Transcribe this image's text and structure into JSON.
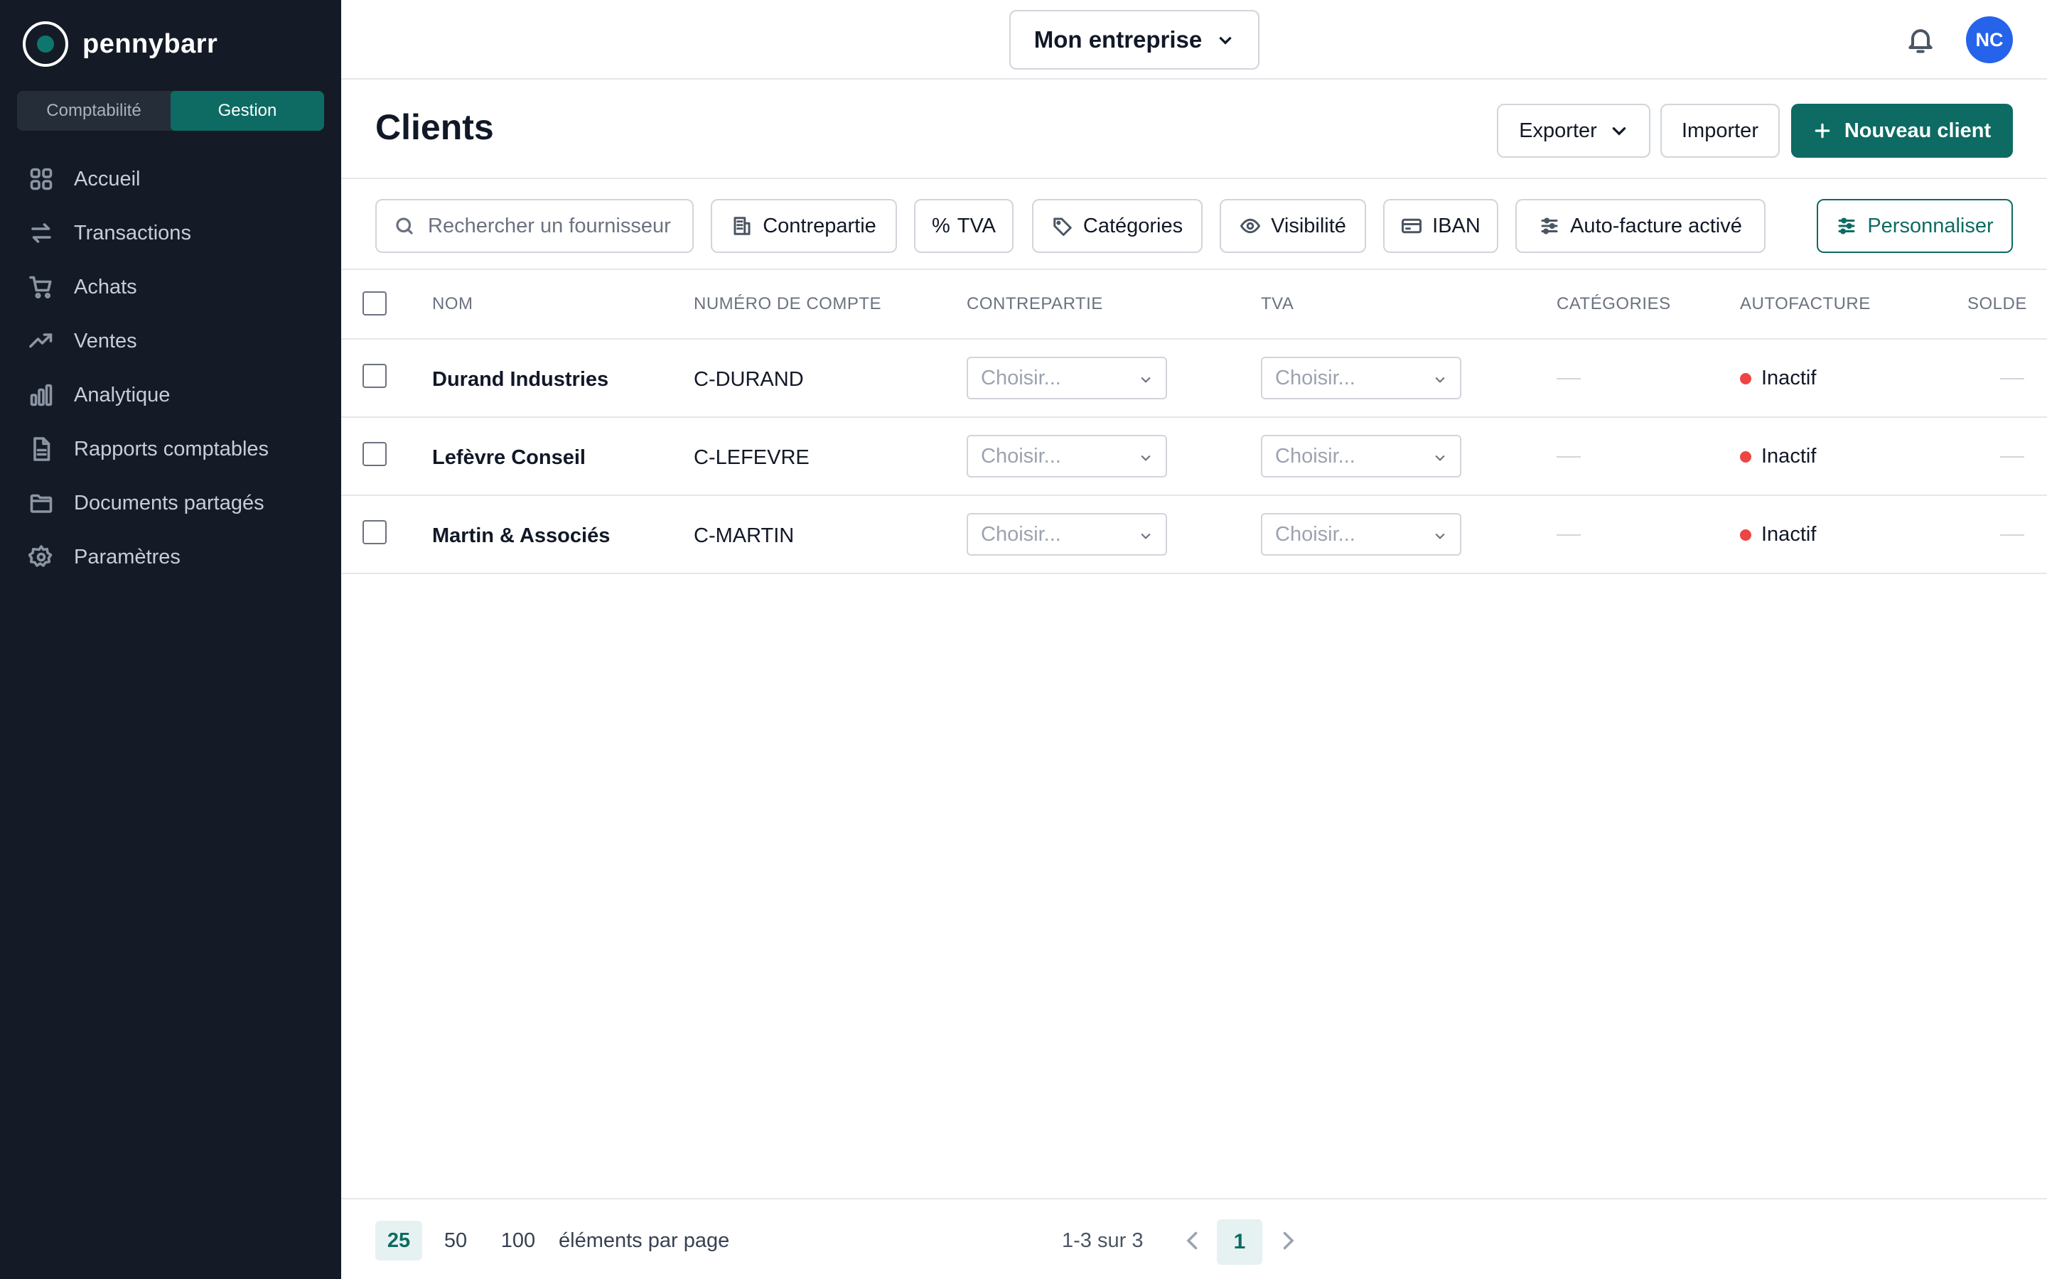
{
  "brand": {
    "name": "pennybarr"
  },
  "mode_switch": {
    "left": "Comptabilité",
    "right": "Gestion"
  },
  "sidebar": {
    "items": [
      {
        "label": "Accueil",
        "icon": "grid-icon"
      },
      {
        "label": "Transactions",
        "icon": "arrows-exchange-icon"
      },
      {
        "label": "Achats",
        "icon": "cart-icon"
      },
      {
        "label": "Ventes",
        "icon": "trending-up-icon"
      },
      {
        "label": "Analytique",
        "icon": "bar-chart-icon"
      },
      {
        "label": "Rapports comptables",
        "icon": "document-icon"
      },
      {
        "label": "Documents partagés",
        "icon": "folder-icon"
      },
      {
        "label": "Paramètres",
        "icon": "gear-icon"
      }
    ]
  },
  "topbar": {
    "company": "Mon entreprise",
    "avatar_initials": "NC"
  },
  "header": {
    "title": "Clients",
    "export_label": "Exporter",
    "import_label": "Importer",
    "new_label": "Nouveau client"
  },
  "filters": {
    "search_placeholder": "Rechercher un fournisseur",
    "contrepartie": "Contrepartie",
    "tva_symbol": "%",
    "tva": "TVA",
    "categories": "Catégories",
    "visibilite": "Visibilité",
    "iban": "IBAN",
    "autofacture": "Auto-facture activé",
    "personnaliser": "Personnaliser"
  },
  "table": {
    "columns": [
      "NOM",
      "NUMÉRO DE COMPTE",
      "CONTREPARTIE",
      "TVA",
      "CATÉGORIES",
      "AUTOFACTURE",
      "SOLDE"
    ],
    "rows": [
      {
        "nom": "Durand Industries",
        "compte": "C-DURAND",
        "contrepartie": "Choisir...",
        "tva": "Choisir...",
        "autofacture": "Inactif"
      },
      {
        "nom": "Lefèvre Conseil",
        "compte": "C-LEFEVRE",
        "contrepartie": "Choisir...",
        "tva": "Choisir...",
        "autofacture": "Inactif"
      },
      {
        "nom": "Martin & Associés",
        "compte": "C-MARTIN",
        "contrepartie": "Choisir...",
        "tva": "Choisir...",
        "autofacture": "Inactif"
      }
    ]
  },
  "footer": {
    "per_page_options": [
      "25",
      "50",
      "100"
    ],
    "per_page_label": "éléments par page",
    "range": "1-3 sur 3",
    "current_page": "1"
  },
  "colors": {
    "sidebar_bg": "#141b26",
    "accent": "#0d6b63",
    "avatar": "#2563eb",
    "status_inactive": "#ef4444"
  }
}
